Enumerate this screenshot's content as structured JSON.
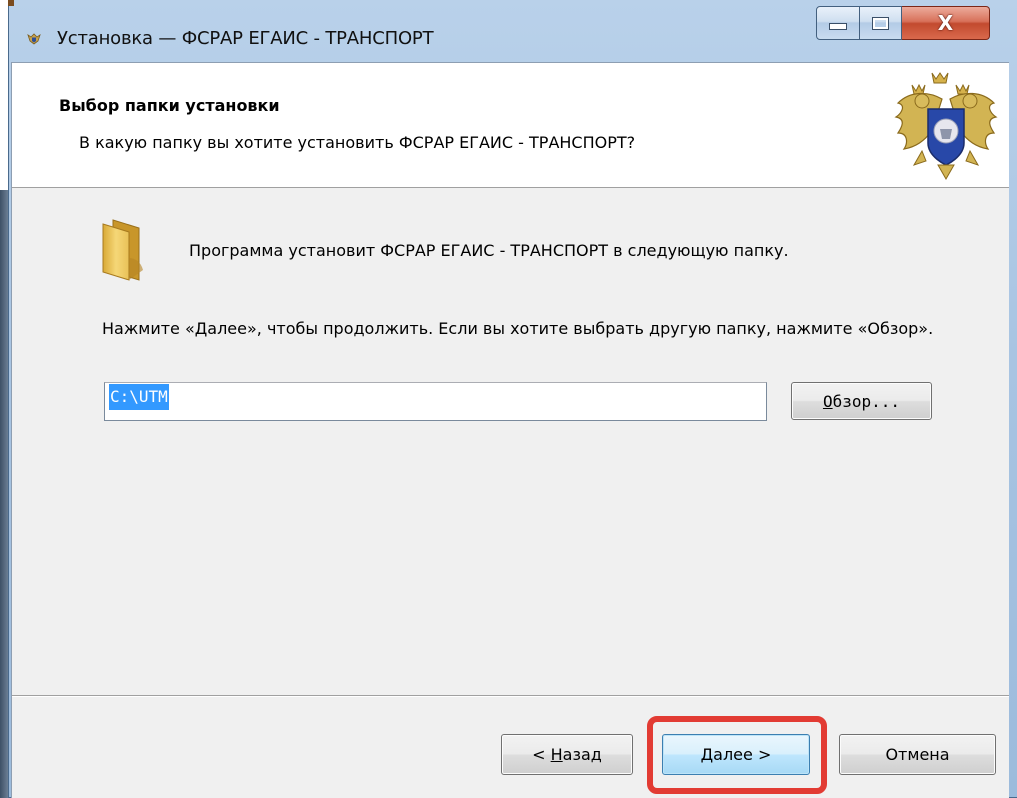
{
  "window": {
    "title": "Установка — ФСРАР ЕГАИС - ТРАНСПОРТ",
    "title_icon": "emblem-icon",
    "minimize_icon": "minimize-icon",
    "maximize_icon": "maximize-icon",
    "close_label": "X"
  },
  "header": {
    "title": "Выбор папки установки",
    "subtitle": "В какую папку вы хотите установить ФСРАР ЕГАИС - ТРАНСПОРТ?",
    "emblem": "double-headed-eagle-emblem-icon"
  },
  "body": {
    "folder_icon": "folder-icon",
    "info": "Программа установит ФСРАР ЕГАИС - ТРАНСПОРТ в следующую папку.",
    "instruction": "Нажмите «Далее», чтобы продолжить. Если вы хотите выбрать другую папку, нажмите «Обзор».",
    "path_value": "C:\\UTM",
    "browse": {
      "mnemonic": "О",
      "rest": "бзор..."
    }
  },
  "footer": {
    "back": {
      "prefix": "< ",
      "mnemonic": "Н",
      "rest": "азад"
    },
    "next": {
      "mnemonic": "Д",
      "rest": "алее >"
    },
    "cancel": "Отмена"
  },
  "colors": {
    "highlight": "#e23b33",
    "selection": "#3399ff",
    "default_button_border": "#3c7fb1"
  }
}
